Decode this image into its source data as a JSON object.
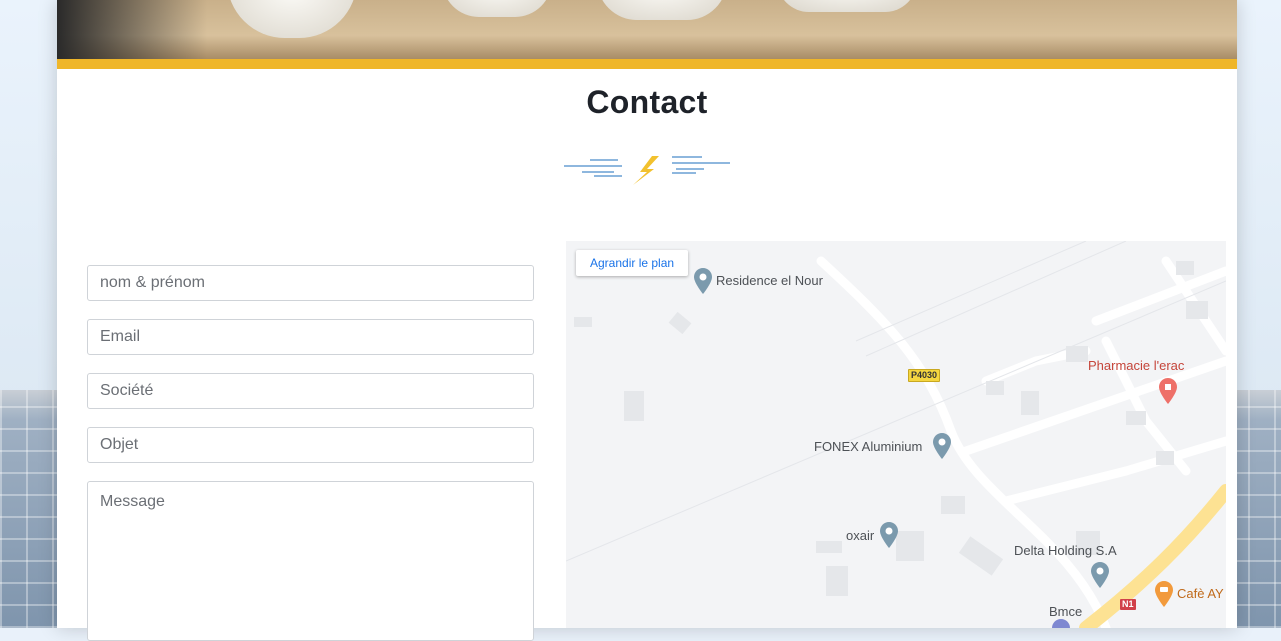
{
  "page": {
    "title": "Contact"
  },
  "form": {
    "name_placeholder": "nom & prénom",
    "email_placeholder": "Email",
    "company_placeholder": "Société",
    "subject_placeholder": "Objet",
    "message_placeholder": "Message"
  },
  "map": {
    "enlarge_label": "Agrandir le plan",
    "places": [
      {
        "label": "Residence el Nour",
        "icon": "map-pin-icon"
      },
      {
        "label": "Pharmacie l'erac",
        "icon": "pharmacy-pin-icon"
      },
      {
        "label": "FONEX Aluminium",
        "icon": "map-pin-icon"
      },
      {
        "label": "oxair",
        "icon": "map-pin-icon"
      },
      {
        "label": "Delta Holding S.A",
        "icon": "map-pin-icon"
      },
      {
        "label": "Bmce",
        "icon": "bank-pin-icon"
      },
      {
        "label": "Cafè AY",
        "icon": "cafe-pin-icon"
      }
    ],
    "road_labels": [
      "P4030",
      "N1"
    ]
  },
  "colors": {
    "accent_gold": "#efb629",
    "title": "#1e2229",
    "map_link": "#1a73e8",
    "divider_blue": "#4a8cc9",
    "lightning": "#f2c12e"
  }
}
